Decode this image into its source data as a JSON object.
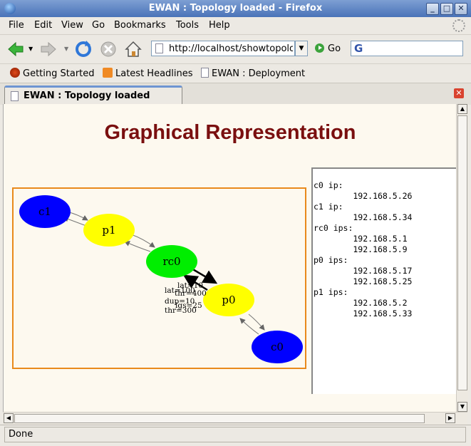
{
  "window": {
    "title": "EWAN : Topology loaded - Firefox",
    "min": "_",
    "max": "□",
    "close": "✕"
  },
  "menu": {
    "file": "File",
    "edit": "Edit",
    "view": "View",
    "go": "Go",
    "bookmarks": "Bookmarks",
    "tools": "Tools",
    "help": "Help"
  },
  "nav": {
    "url": "http://localhost/showtopology",
    "go_label": "Go",
    "search_placeholder": ""
  },
  "bookmarks_bar": [
    {
      "label": "Getting Started",
      "icon": "firefox-icon"
    },
    {
      "label": "Latest Headlines",
      "icon": "rss-icon"
    },
    {
      "label": "EWAN : Deployment",
      "icon": "page-icon"
    }
  ],
  "tab": {
    "label": "EWAN : Topology loaded"
  },
  "page": {
    "heading": "Graphical Representation",
    "graph": {
      "nodes": [
        {
          "id": "c1",
          "label": "c1",
          "color": "#0000ff"
        },
        {
          "id": "p1",
          "label": "p1",
          "color": "#ffff00"
        },
        {
          "id": "rc0",
          "label": "rc0",
          "color": "#00ee00"
        },
        {
          "id": "p0",
          "label": "p0",
          "color": "#ffff00"
        },
        {
          "id": "c0",
          "label": "c0",
          "color": "#0000ff"
        }
      ],
      "edge_labels": {
        "forward": [
          "lat=10",
          "thr=400",
          "lgs=25"
        ],
        "reverse": [
          "lat=100",
          "dup=10",
          "thr=300"
        ]
      }
    },
    "ip_lines": [
      "c0 ip:",
      "        192.168.5.26",
      "c1 ip:",
      "        192.168.5.34",
      "rc0 ips:",
      "        192.168.5.1",
      "        192.168.5.9",
      "p0 ips:",
      "        192.168.5.17",
      "        192.168.5.25",
      "p1 ips:",
      "        192.168.5.2",
      "        192.168.5.33"
    ]
  },
  "status": {
    "text": "Done"
  }
}
